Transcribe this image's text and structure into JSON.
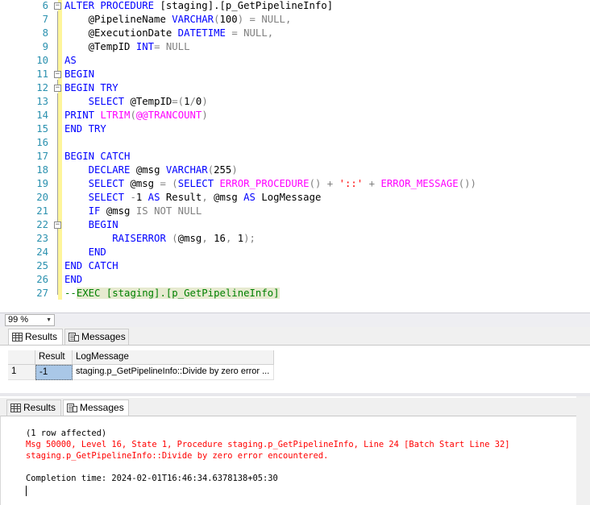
{
  "editor": {
    "lines": [
      {
        "n": "6",
        "fold": "minus",
        "tokens": [
          [
            "kw",
            "ALTER PROCEDURE "
          ],
          [
            "",
            "[staging].[p_GetPipelineInfo]"
          ]
        ]
      },
      {
        "n": "7",
        "tokens": [
          [
            "",
            "    @PipelineName "
          ],
          [
            "kw",
            "VARCHAR"
          ],
          [
            "op",
            "("
          ],
          [
            "",
            "100"
          ],
          [
            "op",
            ")"
          ],
          [
            "",
            " "
          ],
          [
            "op",
            "= NULL,"
          ]
        ]
      },
      {
        "n": "8",
        "tokens": [
          [
            "",
            "    @ExecutionDate "
          ],
          [
            "kw",
            "DATETIME"
          ],
          [
            "",
            " "
          ],
          [
            "op",
            "= NULL,"
          ]
        ]
      },
      {
        "n": "9",
        "tokens": [
          [
            "",
            "    @TempID "
          ],
          [
            "kw",
            "INT"
          ],
          [
            "op",
            "= NULL"
          ]
        ]
      },
      {
        "n": "10",
        "tokens": [
          [
            "kw",
            "AS"
          ]
        ]
      },
      {
        "n": "11",
        "fold": "minus",
        "tokens": [
          [
            "kw",
            "BEGIN"
          ]
        ]
      },
      {
        "n": "12",
        "fold": "minus",
        "tokens": [
          [
            "kw",
            "BEGIN TRY"
          ]
        ]
      },
      {
        "n": "13",
        "tokens": [
          [
            "",
            "    "
          ],
          [
            "kw",
            "SELECT"
          ],
          [
            "",
            " @TempID"
          ],
          [
            "op",
            "=("
          ],
          [
            "",
            "1"
          ],
          [
            "op",
            "/"
          ],
          [
            "",
            "0"
          ],
          [
            "op",
            ")"
          ]
        ]
      },
      {
        "n": "14",
        "tokens": [
          [
            "kw",
            "PRINT"
          ],
          [
            "",
            " "
          ],
          [
            "fn",
            "LTRIM"
          ],
          [
            "op",
            "("
          ],
          [
            "fn",
            "@@TRANCOUNT"
          ],
          [
            "op",
            ")"
          ]
        ]
      },
      {
        "n": "15",
        "tokens": [
          [
            "kw",
            "END TRY"
          ]
        ]
      },
      {
        "n": "16",
        "tokens": [
          [
            "",
            ""
          ]
        ]
      },
      {
        "n": "17",
        "tokens": [
          [
            "kw",
            "BEGIN CATCH"
          ]
        ]
      },
      {
        "n": "18",
        "tokens": [
          [
            "",
            "    "
          ],
          [
            "kw",
            "DECLARE"
          ],
          [
            "",
            " @msg "
          ],
          [
            "kw",
            "VARCHAR"
          ],
          [
            "op",
            "("
          ],
          [
            "",
            "255"
          ],
          [
            "op",
            ")"
          ]
        ]
      },
      {
        "n": "19",
        "tokens": [
          [
            "",
            "    "
          ],
          [
            "kw",
            "SELECT"
          ],
          [
            "",
            " @msg "
          ],
          [
            "op",
            "= ("
          ],
          [
            "kw",
            "SELECT"
          ],
          [
            "",
            " "
          ],
          [
            "fn",
            "ERROR_PROCEDURE"
          ],
          [
            "op",
            "() + "
          ],
          [
            "st",
            "'::'"
          ],
          [
            "op",
            " + "
          ],
          [
            "fn",
            "ERROR_MESSAGE"
          ],
          [
            "op",
            "())"
          ]
        ]
      },
      {
        "n": "20",
        "tokens": [
          [
            "",
            "    "
          ],
          [
            "kw",
            "SELECT"
          ],
          [
            "",
            " "
          ],
          [
            "op",
            "-"
          ],
          [
            "",
            "1 "
          ],
          [
            "kw",
            "AS"
          ],
          [
            "",
            " Result"
          ],
          [
            "op",
            ","
          ],
          [
            "",
            " @msg "
          ],
          [
            "kw",
            "AS"
          ],
          [
            "",
            " LogMessage"
          ]
        ]
      },
      {
        "n": "21",
        "tokens": [
          [
            "",
            "    "
          ],
          [
            "kw",
            "IF"
          ],
          [
            "",
            " @msg "
          ],
          [
            "op",
            "IS NOT NULL"
          ]
        ]
      },
      {
        "n": "22",
        "fold": "minus",
        "tokens": [
          [
            "",
            "    "
          ],
          [
            "kw",
            "BEGIN"
          ]
        ]
      },
      {
        "n": "23",
        "tokens": [
          [
            "",
            "        "
          ],
          [
            "kw",
            "RAISERROR"
          ],
          [
            "",
            " "
          ],
          [
            "op",
            "("
          ],
          [
            "",
            "@msg"
          ],
          [
            "op",
            ","
          ],
          [
            "",
            " 16"
          ],
          [
            "op",
            ","
          ],
          [
            "",
            " 1"
          ],
          [
            "op",
            ");"
          ]
        ]
      },
      {
        "n": "24",
        "tokens": [
          [
            "",
            "    "
          ],
          [
            "kw",
            "END"
          ]
        ]
      },
      {
        "n": "25",
        "tokens": [
          [
            "kw",
            "END CATCH"
          ]
        ]
      },
      {
        "n": "26",
        "tokens": [
          [
            "kw",
            "END"
          ]
        ]
      },
      {
        "n": "27",
        "tokens": [
          [
            "cm",
            "--"
          ],
          [
            "cm hl",
            "EXEC [staging].[p_GetPipelineInfo]"
          ]
        ]
      }
    ]
  },
  "zoom": {
    "value": "99 %"
  },
  "tabs_top": {
    "results": "Results",
    "messages": "Messages"
  },
  "grid": {
    "headers": [
      "Result",
      "LogMessage"
    ],
    "rows": [
      {
        "row_num": "1",
        "result": "-1",
        "log_message": "staging.p_GetPipelineInfo::Divide by zero error ..."
      }
    ]
  },
  "tabs_bottom": {
    "results": "Results",
    "messages": "Messages"
  },
  "messages": {
    "line1": "(1 row affected)",
    "line2": "Msg 50000, Level 16, State 1, Procedure staging.p_GetPipelineInfo, Line 24 [Batch Start Line 32]",
    "line3": "staging.p_GetPipelineInfo::Divide by zero error encountered.",
    "line4": "Completion time: 2024-02-01T16:46:34.6378138+05:30"
  },
  "colors": {
    "keyword": "#0000ff",
    "function": "#ff00ff",
    "string": "#ff0000",
    "operator": "#808080",
    "comment": "#008000",
    "line_number": "#2b91af",
    "error": "#ff0000"
  },
  "icons": {
    "results_tab": "grid-icon",
    "messages_tab": "messages-icon"
  }
}
